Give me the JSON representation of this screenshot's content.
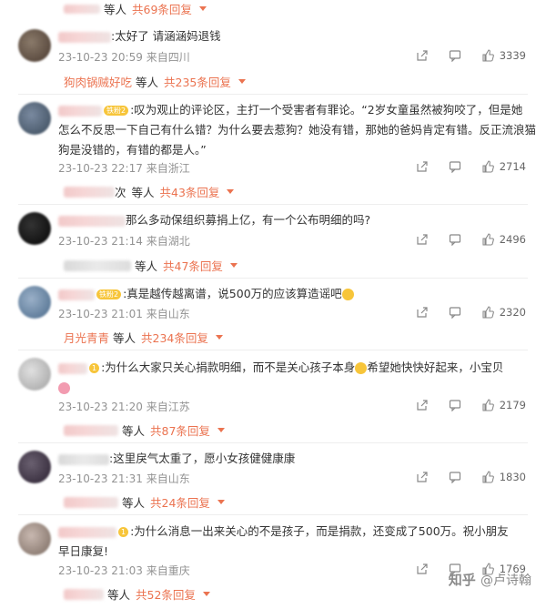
{
  "top_reply": {
    "suffix": "等人",
    "total": "共69条回复"
  },
  "comments": [
    {
      "text": ":太好了 请涵涵妈退钱",
      "time": "23-10-23 20:59",
      "loc": "来自四川",
      "likes": "3339",
      "reply_name": "狗肉锅贼好吃",
      "reply_suffix": "等人",
      "reply_total": "共235条回复"
    },
    {
      "badge": "铁粉2",
      "text1": ":叹为观止的评论区，主打一个受害者有罪论。“2岁女童虽然被狗咬了，但是她",
      "text2": "怎么不反思一下自己有什么错？为什么要去惹狗？她没有错，那她的爸妈肯定有错。反正流浪猫",
      "text3": "狗是没错的，有错的都是人。”",
      "time": "23-10-23 22:17",
      "loc": "来自浙江",
      "likes": "2714",
      "reply_suffix": "等人",
      "reply_name_tail": "次",
      "reply_total": "共43条回复"
    },
    {
      "text": "那么多动保组织募捐上亿，有一个公布明细的吗?",
      "time": "23-10-23 21:14",
      "loc": "来自湖北",
      "likes": "2496",
      "reply_suffix": "等人",
      "reply_total": "共47条回复"
    },
    {
      "badge": "铁粉2",
      "text": ":真是越传越离谱，说500万的应该算造谣吧",
      "time": "23-10-23 21:01",
      "loc": "来自山东",
      "likes": "2320",
      "reply_name": "月光青青",
      "reply_suffix": "等人",
      "reply_total": "共234条回复"
    },
    {
      "badge": "1",
      "text1": ":为什么大家只关心捐款明细，而不是关心孩子本身",
      "text1b": "希望她快快好起来，小宝贝",
      "time": "23-10-23 21:20",
      "loc": "来自江苏",
      "likes": "2179",
      "reply_suffix": "等人",
      "reply_total": "共87条回复"
    },
    {
      "text": ":这里戾气太重了，愿小女孩健健康康",
      "time": "23-10-23 21:31",
      "loc": "来自山东",
      "likes": "1830",
      "reply_suffix": "等人",
      "reply_total": "共24条回复"
    },
    {
      "badge": "1",
      "text1": ":为什么消息一出来关心的不是孩子，而是捐款，还变成了500万。祝小朋友",
      "text2": "早日康复!",
      "time": "23-10-23 21:03",
      "loc": "来自重庆",
      "likes": "1769",
      "reply_suffix": "等人",
      "reply_total": "共52条回复"
    }
  ],
  "watermark": {
    "site": "知乎",
    "author": "@卢诗翰"
  },
  "icons": {
    "share": "share-icon",
    "comment": "comment-icon",
    "like": "thumbs-up-icon"
  },
  "colors": {
    "accent": "#eb7350",
    "meta": "#939393"
  }
}
